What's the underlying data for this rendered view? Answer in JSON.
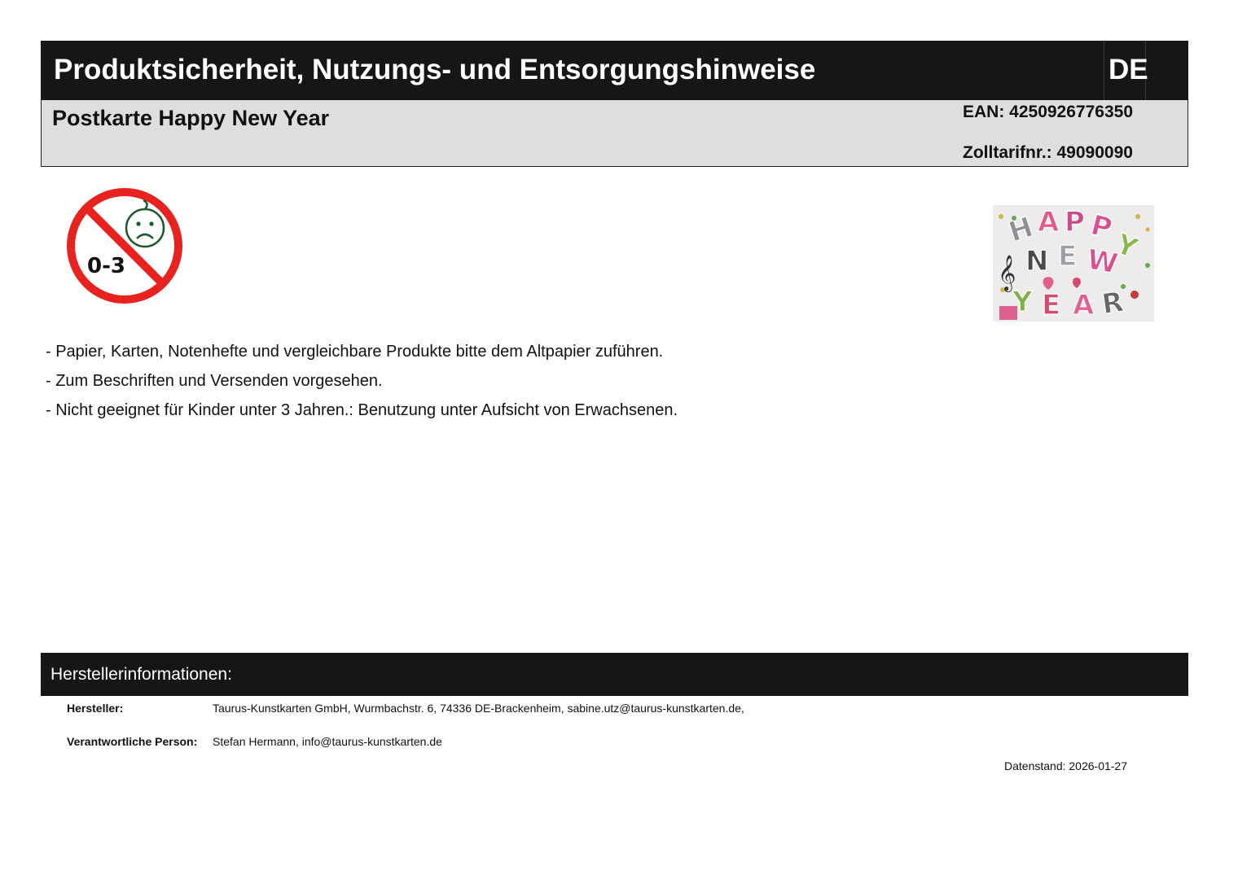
{
  "header": {
    "title": "Produktsicherheit, Nutzungs- und Entsorgungshinweise",
    "language": "DE"
  },
  "product": {
    "name": "Postkarte Happy New Year",
    "ean": "EAN: 4250926776350",
    "customs": "Zolltarifnr.: 49090090"
  },
  "age_warning": {
    "label": "0-3",
    "icon": "not-for-children-under-3-icon",
    "colors": {
      "ring": "#e8221e",
      "face": "#1f5a26"
    }
  },
  "product_image": {
    "text": [
      "H",
      "A",
      "P",
      "P",
      "Y",
      "N",
      "E",
      "W",
      "Y",
      "E",
      "A",
      "R"
    ]
  },
  "notes": [
    "- Papier, Karten, Notenhefte und vergleichbare Produkte bitte dem Altpapier zuführen.",
    "- Zum Beschriften und Versenden vorgesehen.",
    "- Nicht geeignet für Kinder unter 3 Jahren.: Benutzung unter Aufsicht von Erwachsenen."
  ],
  "manufacturer": {
    "heading": "Herstellerinformationen:",
    "maker_label": "Hersteller:",
    "maker_value": "Taurus-Kunstkarten GmbH, Wurmbachstr. 6, 74336 DE-Brackenheim, sabine.utz@taurus-kunstkarten.de,",
    "responsible_label": "Verantwortliche Person:",
    "responsible_value": "Stefan Hermann, info@taurus-kunstkarten.de"
  },
  "data_date": "Datenstand: 2026-01-27"
}
